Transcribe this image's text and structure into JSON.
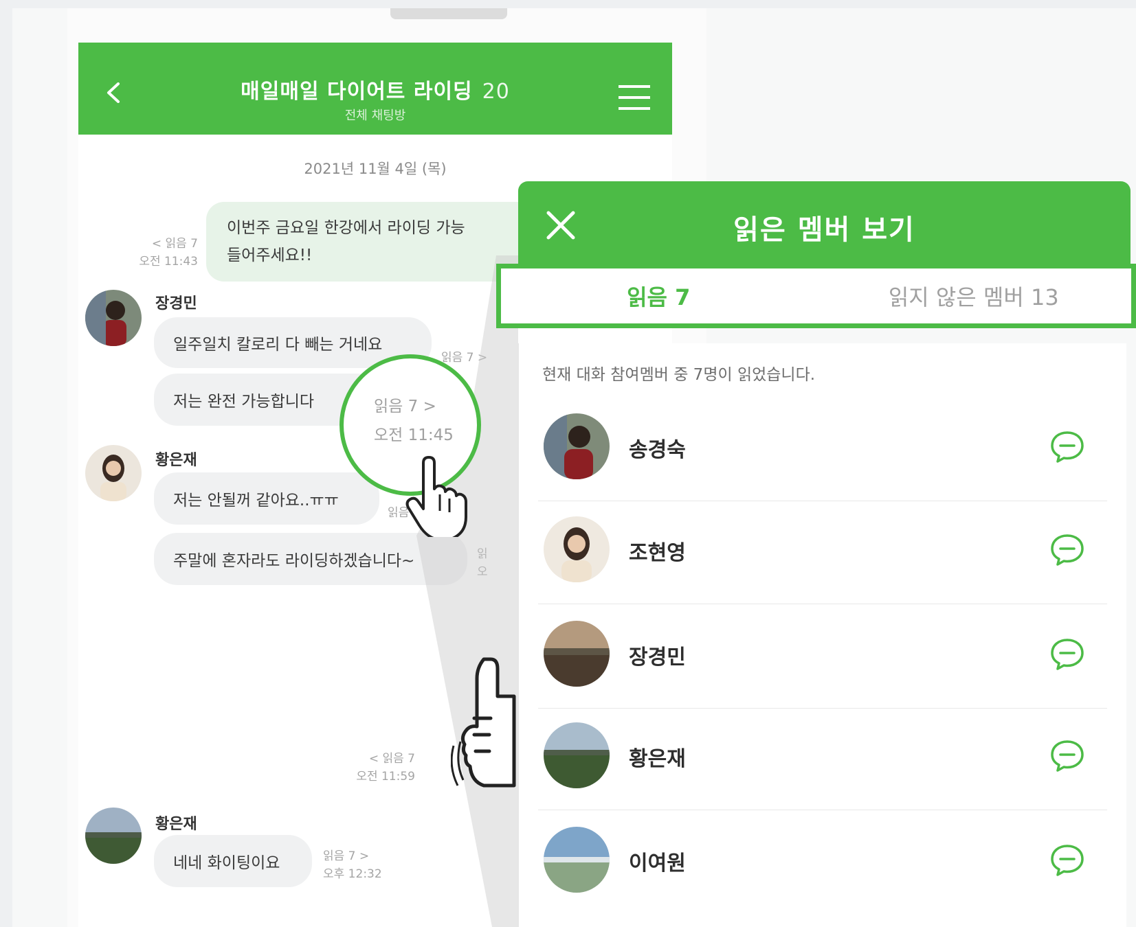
{
  "chat": {
    "title": "매일매일 다이어트 라이딩",
    "member_count": "20",
    "subtitle": "전체 채팅방",
    "date": "2021년 11월 4일 (목)",
    "messages": {
      "my_line1": "이번주 금요일 한강에서 라이딩 가능",
      "my_line2": "들어주세요!!",
      "my_read": "< 읽음 7",
      "my_time": "오전 11:43",
      "sender1": "장경민",
      "s1_msg1": "일주일치 칼로리 다 빼는 거네요",
      "s1_msg2": "저는 완전 가능합니다",
      "s1_read": "읽음 7 >",
      "sender2": "황은재",
      "s2_msg1": "저는 안될꺼 같아요..ㅠㅠ",
      "s2_read": "읽음 7 >",
      "s2_msg2": "주말에 혼자라도 라이딩하겠습니다~",
      "s2_read2": "읽",
      "s2_time2": "오",
      "mid_read": "< 읽음 7",
      "mid_time": "오전 11:59",
      "sender3": "황은재",
      "s3_msg1": "네네 화이팅이요",
      "s3_read": "읽음 7 >",
      "s3_time": "오후 12:32"
    }
  },
  "zoom": {
    "read": "읽음 7 >",
    "time": "오전 11:45"
  },
  "panel": {
    "title": "읽은 멤버 보기",
    "tabs": {
      "read": "읽음 7",
      "unread": "읽지 않은 멤버 13"
    },
    "note": "현재 대화 참여멤버 중 7명이 읽었습니다.",
    "members": [
      {
        "name": "송경숙"
      },
      {
        "name": "조현영"
      },
      {
        "name": "장경민"
      },
      {
        "name": "황은재"
      },
      {
        "name": "이여원"
      }
    ]
  },
  "colors": {
    "accent": "#4cbb46",
    "my_bubble": "#e7f3e8",
    "bubble": "#f0f1f2"
  }
}
